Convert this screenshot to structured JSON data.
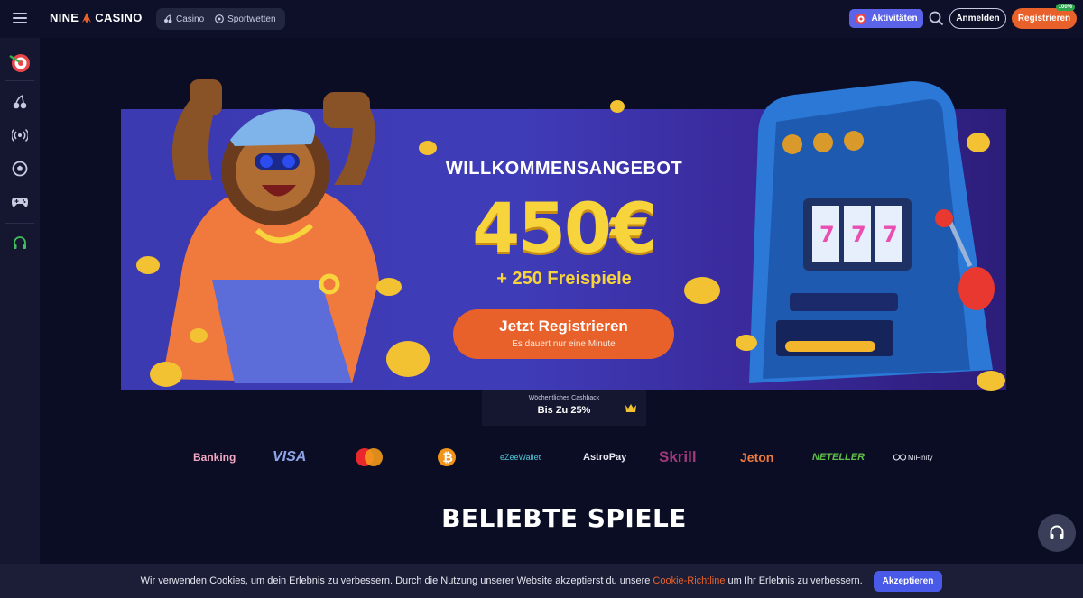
{
  "header": {
    "logo_left": "NINE",
    "logo_right": "CASINO",
    "nav": [
      {
        "label": "Casino",
        "icon": "cherry-icon"
      },
      {
        "label": "Sportwetten",
        "icon": "soccer-ball-icon"
      }
    ],
    "activity_label": "Aktivitäten",
    "login_label": "Anmelden",
    "register_label": "Registrieren",
    "register_badge": "100%"
  },
  "sidebar": {
    "items": [
      {
        "name": "dart-target-icon"
      },
      {
        "name": "cherry-icon"
      },
      {
        "name": "live-broadcast-icon"
      },
      {
        "name": "soccer-ball-icon"
      },
      {
        "name": "gamepad-icon"
      },
      {
        "name": "headset-icon"
      }
    ]
  },
  "banner": {
    "title": "WILLKOMMENSANGEBOT",
    "amount": "450€",
    "spins": "+ 250 Freispiele",
    "cta_label": "Jetzt Registrieren",
    "cta_sub": "Es dauert nur eine Minute"
  },
  "cashback": {
    "label": "Wöchentliches Cashback",
    "value": "Bis Zu 25%"
  },
  "payments": [
    "Banking",
    "VISA",
    "Mastercard",
    "Bitcoin",
    "eZeeWallet",
    "AstroPay",
    "Skrill",
    "Jeton",
    "NETELLER",
    "MiFinity"
  ],
  "section_title": "BELIEBTE SPIELE",
  "cookie": {
    "text_before": "Wir verwenden Cookies, um dein Erlebnis zu verbessern. Durch die Nutzung unserer Website akzeptierst du unsere",
    "link": "Cookie-Richtline",
    "text_after": "um Ihr Erlebnis zu verbessern.",
    "accept_label": "Akzeptieren"
  },
  "colors": {
    "accent_orange": "#e8612a",
    "gold": "#f7d33c",
    "activity_blue": "#5b64e8"
  }
}
